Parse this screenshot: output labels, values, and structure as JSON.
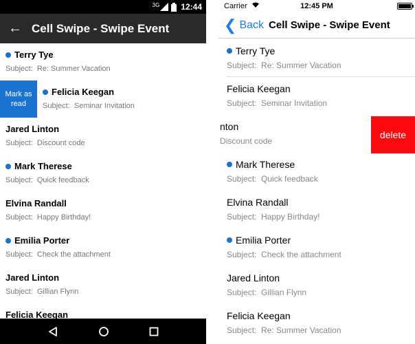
{
  "android": {
    "status": {
      "network": "3G",
      "time": "12:44"
    },
    "toolbar": {
      "title": "Cell Swipe - Swipe Event"
    },
    "swipe_action": {
      "label": "Mark as read"
    },
    "subject_prefix": "Subject:",
    "items": [
      {
        "name": "Terry Tye",
        "subject": "Re: Summer Vacation",
        "unread": true
      },
      {
        "name": "Felicia Keegan",
        "subject": "Seminar Invitation",
        "unread": true
      },
      {
        "name": "Jared Linton",
        "subject": "Discount code",
        "unread": false
      },
      {
        "name": "Mark Therese",
        "subject": "Quick feedback",
        "unread": true
      },
      {
        "name": "Elvina Randall",
        "subject": "Happy Birthday!",
        "unread": false
      },
      {
        "name": "Emilia Porter",
        "subject": "Check the attachment",
        "unread": true
      },
      {
        "name": "Jared Linton",
        "subject": "Gillian Flynn",
        "unread": false
      },
      {
        "name": "Felicia Keegan",
        "subject": "",
        "unread": false
      }
    ],
    "nav": {
      "back_icon": "triangle-back-icon",
      "home_icon": "circle-home-icon",
      "recents_icon": "square-recents-icon"
    }
  },
  "ios": {
    "status": {
      "carrier": "Carrier",
      "time": "12:45 PM"
    },
    "nav": {
      "back_label": "Back",
      "title": "Cell Swipe - Swipe Event"
    },
    "swipe_action": {
      "label": "delete"
    },
    "subject_prefix": "Subject:",
    "items": [
      {
        "name": "Terry Tye",
        "subject": "Re: Summer Vacation",
        "unread": true
      },
      {
        "name": "Felicia Keegan",
        "subject": "Seminar Invitation",
        "unread": false
      },
      {
        "name": "nton",
        "subject": "Discount code",
        "unread": false,
        "swiped": true
      },
      {
        "name": "Mark Therese",
        "subject": "Quick feedback",
        "unread": true
      },
      {
        "name": "Elvina Randall",
        "subject": "Happy Birthday!",
        "unread": false
      },
      {
        "name": "Emilia Porter",
        "subject": "Check the attachment",
        "unread": true
      },
      {
        "name": "Jared Linton",
        "subject": "Gillian Flynn",
        "unread": false
      },
      {
        "name": "Felicia Keegan",
        "subject": "Re: Summer Vacation",
        "unread": false
      }
    ]
  },
  "colors": {
    "accent_blue": "#1a73d1",
    "ios_blue": "#1a7cf5",
    "delete_red": "#fb0a0f",
    "toolbar": "#2b2b2b"
  }
}
